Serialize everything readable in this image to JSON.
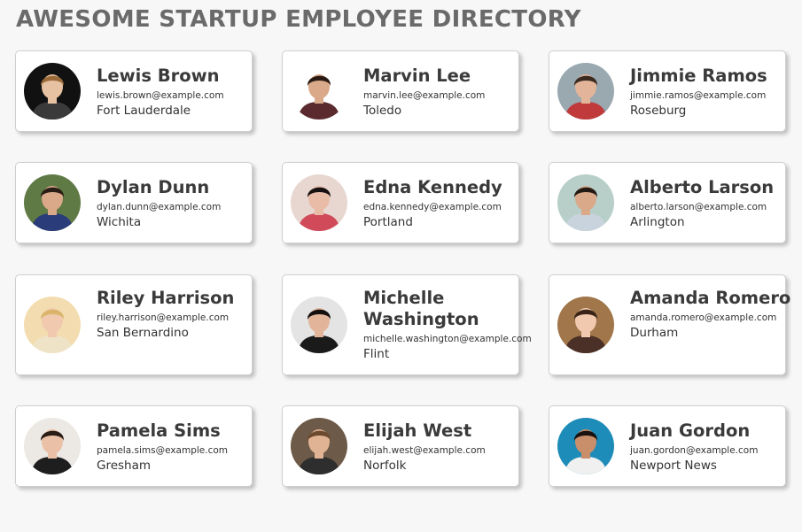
{
  "title": "AWESOME STARTUP EMPLOYEE DIRECTORY",
  "employees": [
    {
      "name": "Lewis Brown",
      "email": "lewis.brown@example.com",
      "city": "Fort Lauderdale",
      "avatar": {
        "bg": "#111111",
        "skin": "#e7c2a2",
        "hair": "#9a6a3a",
        "shirt": "#3a3a3a"
      }
    },
    {
      "name": "Marvin Lee",
      "email": "marvin.lee@example.com",
      "city": "Toledo",
      "avatar": {
        "bg": "#ffffff",
        "skin": "#d9a98a",
        "hair": "#2a1a14",
        "shirt": "#5a2a2e"
      }
    },
    {
      "name": "Jimmie Ramos",
      "email": "jimmie.ramos@example.com",
      "city": "Roseburg",
      "avatar": {
        "bg": "#9aa8b0",
        "skin": "#e2b59a",
        "hair": "#3a2a20",
        "shirt": "#c0393b"
      }
    },
    {
      "name": "Dylan Dunn",
      "email": "dylan.dunn@example.com",
      "city": "Wichita",
      "avatar": {
        "bg": "#5f7a45",
        "skin": "#d9a98a",
        "hair": "#2a1d16",
        "shirt": "#2a3c7a"
      }
    },
    {
      "name": "Edna Kennedy",
      "email": "edna.kennedy@example.com",
      "city": "Portland",
      "avatar": {
        "bg": "#e8d7d0",
        "skin": "#e9bca8",
        "hair": "#161010",
        "shirt": "#d04a5a"
      }
    },
    {
      "name": "Alberto Larson",
      "email": "alberto.larson@example.com",
      "city": "Arlington",
      "avatar": {
        "bg": "#b8cfc9",
        "skin": "#d9a98a",
        "hair": "#241a14",
        "shirt": "#c9d3de"
      }
    },
    {
      "name": "Riley Harrison",
      "email": "riley.harrison@example.com",
      "city": "San Bernardino",
      "avatar": {
        "bg": "#f3ddb0",
        "skin": "#f0c9ae",
        "hair": "#d9b46a",
        "shirt": "#efe3c7"
      }
    },
    {
      "name": "Michelle Washington",
      "email": "michelle.washington@example.com",
      "city": "Flint",
      "avatar": {
        "bg": "#e4e4e4",
        "skin": "#e2b59a",
        "hair": "#141010",
        "shirt": "#1a1a1a"
      }
    },
    {
      "name": "Amanda Romero",
      "email": "amanda.romero@example.com",
      "city": "Durham",
      "avatar": {
        "bg": "#a0764a",
        "skin": "#f0c9ae",
        "hair": "#3a2418",
        "shirt": "#4a3026"
      }
    },
    {
      "name": "Pamela Sims",
      "email": "pamela.sims@example.com",
      "city": "Gresham",
      "avatar": {
        "bg": "#ece8e4",
        "skin": "#eac1a6",
        "hair": "#2a1d16",
        "shirt": "#1e1e1e"
      }
    },
    {
      "name": "Elijah West",
      "email": "elijah.west@example.com",
      "city": "Norfolk",
      "avatar": {
        "bg": "#6d5a48",
        "skin": "#e0b394",
        "hair": "#6b4a2e",
        "shirt": "#2e2e2e"
      }
    },
    {
      "name": "Juan Gordon",
      "email": "juan.gordon@example.com",
      "city": "Newport News",
      "avatar": {
        "bg": "#1e8cb8",
        "skin": "#c98e6a",
        "hair": "#1a1210",
        "shirt": "#f0f0f0"
      }
    }
  ]
}
